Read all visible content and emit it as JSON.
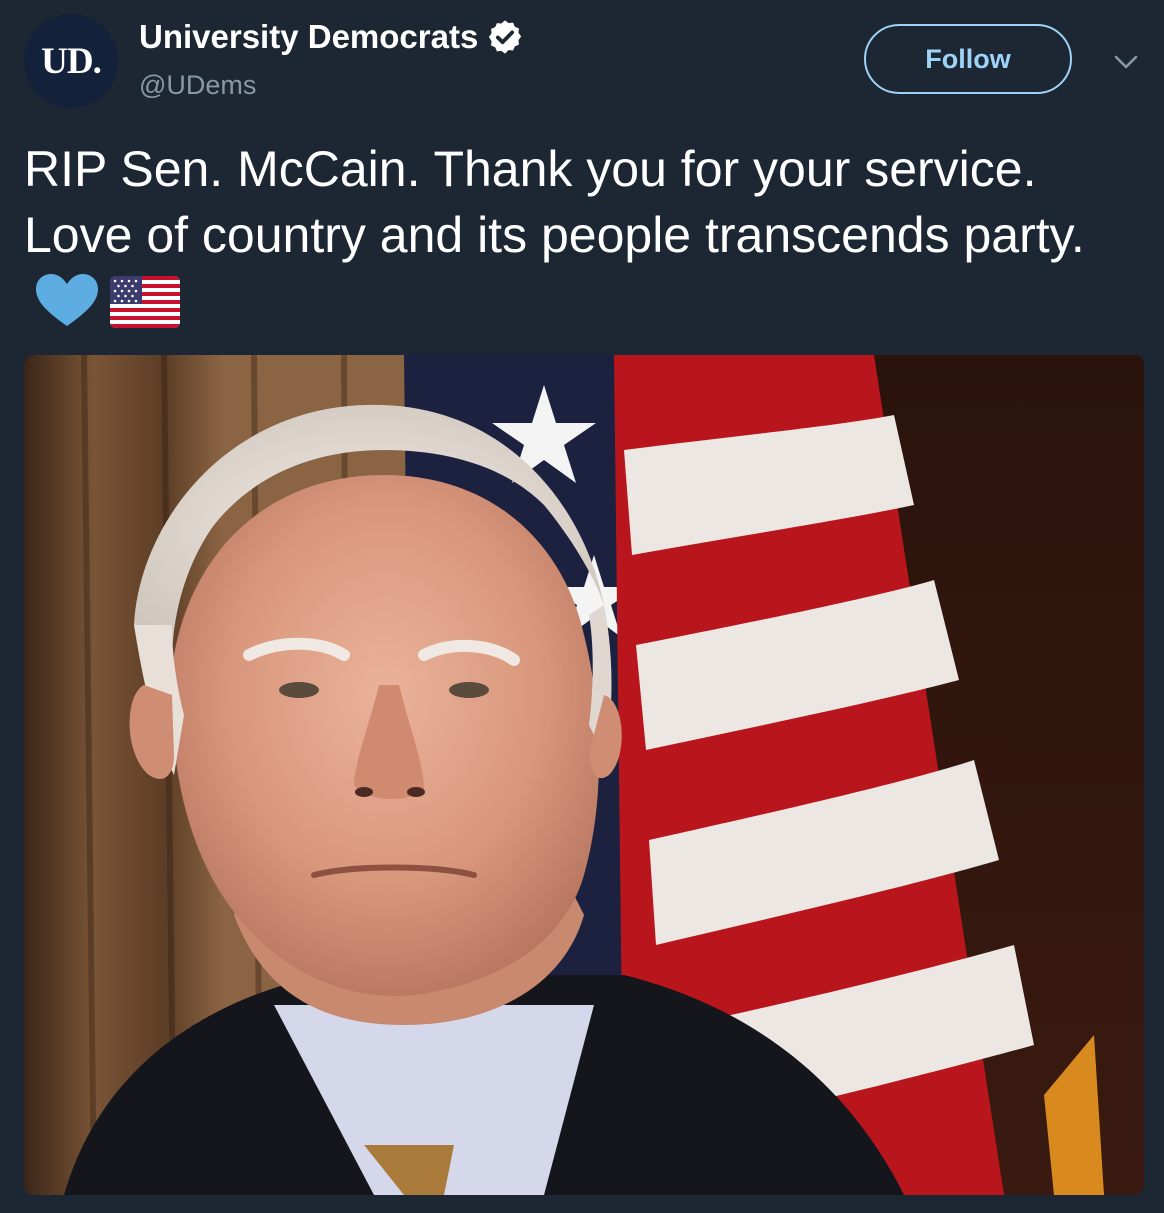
{
  "author": {
    "avatar_text": "UD.",
    "display_name": "University Democrats",
    "handle": "@UDems",
    "verified": true
  },
  "follow_label": "Follow",
  "tweet": {
    "text": "RIP Sen. McCain. Thank you for your service. Love of country and its people transcends party.",
    "emojis": [
      "blue-heart-icon",
      "us-flag-icon"
    ]
  },
  "media": {
    "description": "photo-portrait"
  },
  "colors": {
    "background": "#1c2733",
    "accent": "#9ed2f7",
    "handle": "#8899a6",
    "avatar": "#14213a"
  }
}
